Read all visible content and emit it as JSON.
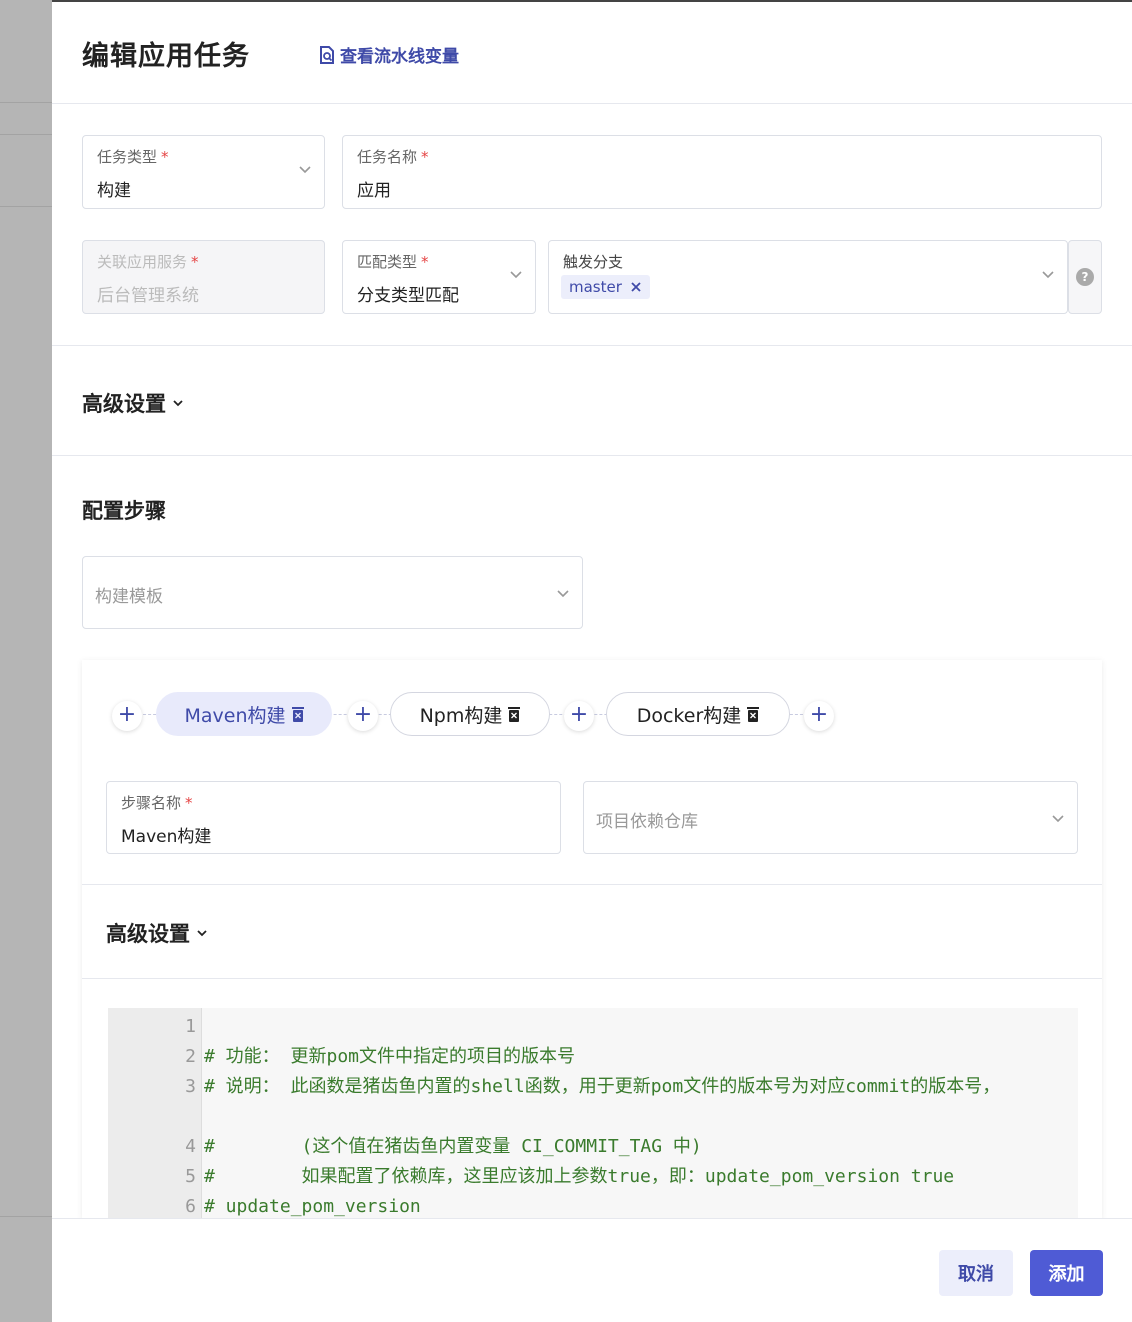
{
  "header": {
    "title": "编辑应用任务",
    "view_vars_label": "查看流水线变量"
  },
  "form": {
    "task_type": {
      "label": "任务类型",
      "value": "构建"
    },
    "task_name": {
      "label": "任务名称",
      "value": "应用"
    },
    "service": {
      "label": "关联应用服务",
      "value": "后台管理系统"
    },
    "match_type": {
      "label": "匹配类型",
      "value": "分支类型匹配"
    },
    "branch": {
      "label": "触发分支",
      "chip": "master"
    },
    "required_mark": "*"
  },
  "advanced_label": "高级设置",
  "steps_section": {
    "title": "配置步骤",
    "template_placeholder": "构建模板",
    "steps": [
      {
        "label": "Maven构建"
      },
      {
        "label": "Npm构建"
      },
      {
        "label": "Docker构建"
      }
    ],
    "step_name": {
      "label": "步骤名称",
      "value": "Maven构建"
    },
    "repo_placeholder": "项目依赖仓库",
    "advanced_label": "高级设置"
  },
  "code": {
    "lines": [
      {
        "num": "1",
        "text": ""
      },
      {
        "num": "2",
        "text": "# 功能： 更新pom文件中指定的项目的版本号"
      },
      {
        "num": "3",
        "text": "# 说明： 此函数是猪齿鱼内置的shell函数，用于更新pom文件的版本号为对应commit的版本号，"
      },
      {
        "num": "4",
        "text": "#        (这个值在猪齿鱼内置变量 CI_COMMIT_TAG 中)"
      },
      {
        "num": "5",
        "text": "#        如果配置了依赖库，这里应该加上参数true，即：update_pom_version true"
      },
      {
        "num": "6",
        "text": "# update_pom_version"
      }
    ]
  },
  "footer": {
    "cancel": "取消",
    "add": "添加"
  },
  "colors": {
    "primary": "#4f5bd5",
    "accent_text": "#3f4aa8",
    "required": "#e54545"
  }
}
